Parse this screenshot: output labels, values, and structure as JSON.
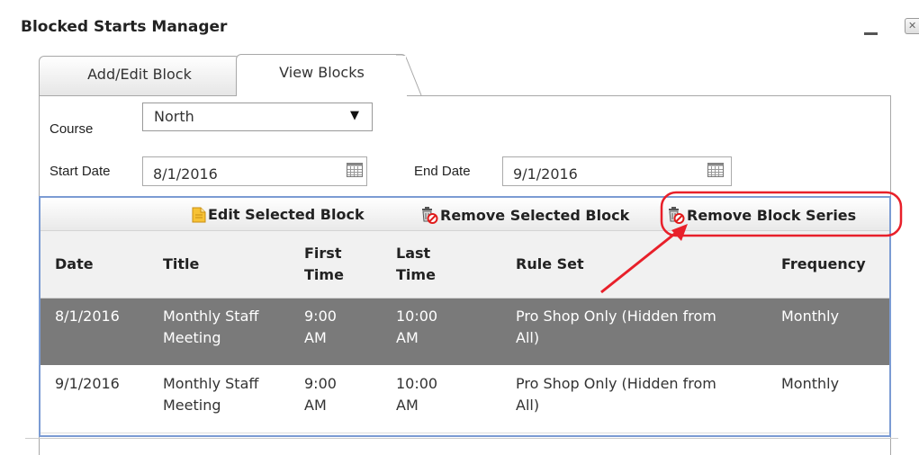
{
  "window": {
    "title": "Blocked Starts Manager",
    "minimize_icon": "minimize-icon",
    "close_icon": "close-icon"
  },
  "tabs": [
    {
      "label": "Add/Edit Block",
      "active": false
    },
    {
      "label": "View Blocks",
      "active": true
    }
  ],
  "filters": {
    "course_label": "Course",
    "course_value": "North",
    "start_label": "Start Date",
    "start_value": "8/1/2016",
    "end_label": "End Date",
    "end_value": "9/1/2016",
    "calendar_icon": "calendar-icon"
  },
  "toolbar": {
    "edit_label": "Edit Selected Block",
    "edit_icon": "edit-document-icon",
    "remove_label": "Remove Selected Block",
    "remove_icon": "trash-delete-icon",
    "series_label": "Remove Block Series",
    "series_icon": "trash-delete-icon"
  },
  "table": {
    "columns": [
      "Date",
      "Title",
      "First Time",
      "Last Time",
      "Rule Set",
      "Frequency"
    ],
    "rows": [
      {
        "date": "8/1/2016",
        "title": "Monthly Staff Meeting",
        "first": "9:00 AM",
        "last": "10:00 AM",
        "rule": "Pro Shop Only (Hidden from All)",
        "freq": "Monthly",
        "selected": true
      },
      {
        "date": "9/1/2016",
        "title": "Monthly Staff Meeting",
        "first": "9:00 AM",
        "last": "10:00 AM",
        "rule": "Pro Shop Only (Hidden from All)",
        "freq": "Monthly",
        "selected": false
      }
    ]
  },
  "colors": {
    "selected_row": "#7a7a7a",
    "grid_border": "#7b9bd3",
    "annotation": "#e8202a"
  }
}
